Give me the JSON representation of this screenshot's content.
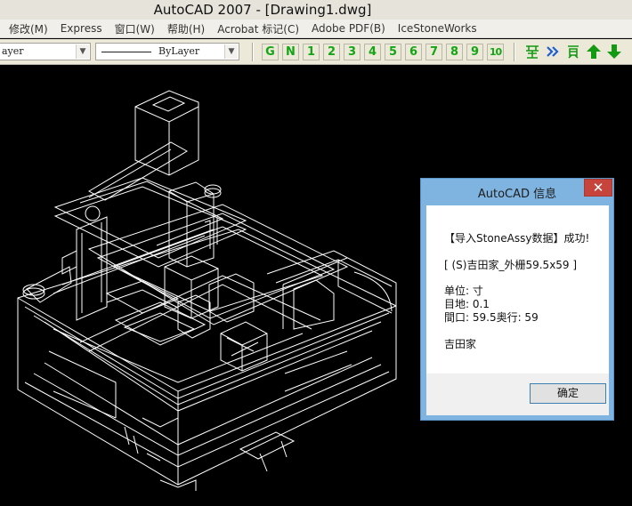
{
  "window": {
    "title": "AutoCAD 2007 - [Drawing1.dwg]"
  },
  "menubar": {
    "items": [
      "修改(M)",
      "Express",
      "窗口(W)",
      "帮助(H)",
      "Acrobat 标记(C)",
      "Adobe PDF(B)",
      "IceStoneWorks"
    ]
  },
  "toolbar": {
    "layer_combo_value": "ayer",
    "linetype_combo_value": "ByLayer",
    "letter_buttons": [
      "G",
      "N"
    ],
    "number_buttons": [
      "1",
      "2",
      "3",
      "4",
      "5",
      "6",
      "7",
      "8",
      "9",
      "10"
    ],
    "icons": [
      "stone-parts-icon",
      "double-chevron-right-icon",
      "page-icon",
      "arrow-up-icon",
      "arrow-down-icon"
    ],
    "accent_color": "#14a514"
  },
  "dialog": {
    "title": "AutoCAD 信息",
    "close_label": "✕",
    "message": "【导入StoneAssy数据】成功!",
    "item": "[ (S)吉田家_外栅59.5x59 ]",
    "unit": "单位: 寸",
    "mesh": "目地: 0.1",
    "size": "間口: 59.5奥行: 59",
    "owner": "吉田家",
    "ok_label": "确定"
  }
}
